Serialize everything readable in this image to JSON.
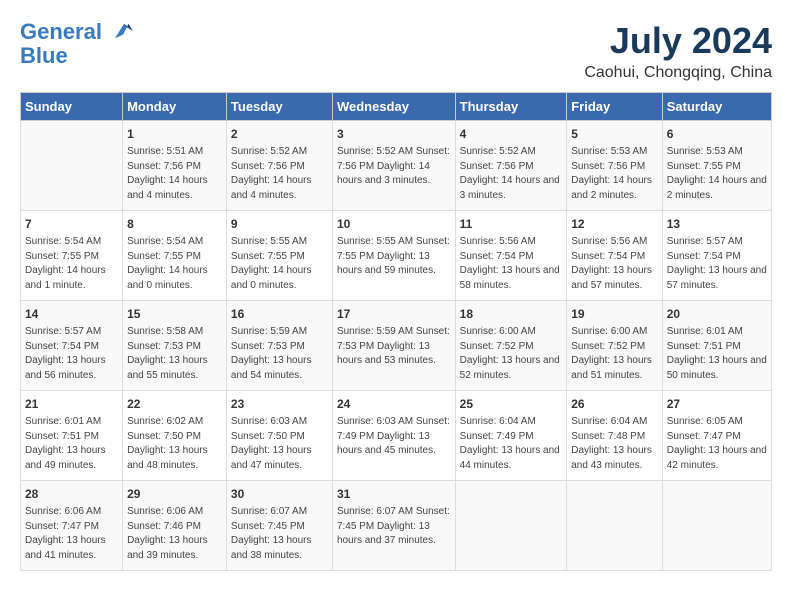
{
  "header": {
    "logo_line1": "General",
    "logo_line2": "Blue",
    "title": "July 2024",
    "subtitle": "Caohui, Chongqing, China"
  },
  "weekdays": [
    "Sunday",
    "Monday",
    "Tuesday",
    "Wednesday",
    "Thursday",
    "Friday",
    "Saturday"
  ],
  "weeks": [
    [
      {
        "day": "",
        "content": ""
      },
      {
        "day": "1",
        "content": "Sunrise: 5:51 AM\nSunset: 7:56 PM\nDaylight: 14 hours\nand 4 minutes."
      },
      {
        "day": "2",
        "content": "Sunrise: 5:52 AM\nSunset: 7:56 PM\nDaylight: 14 hours\nand 4 minutes."
      },
      {
        "day": "3",
        "content": "Sunrise: 5:52 AM\nSunset: 7:56 PM\nDaylight: 14 hours\nand 3 minutes."
      },
      {
        "day": "4",
        "content": "Sunrise: 5:52 AM\nSunset: 7:56 PM\nDaylight: 14 hours\nand 3 minutes."
      },
      {
        "day": "5",
        "content": "Sunrise: 5:53 AM\nSunset: 7:56 PM\nDaylight: 14 hours\nand 2 minutes."
      },
      {
        "day": "6",
        "content": "Sunrise: 5:53 AM\nSunset: 7:55 PM\nDaylight: 14 hours\nand 2 minutes."
      }
    ],
    [
      {
        "day": "7",
        "content": "Sunrise: 5:54 AM\nSunset: 7:55 PM\nDaylight: 14 hours\nand 1 minute."
      },
      {
        "day": "8",
        "content": "Sunrise: 5:54 AM\nSunset: 7:55 PM\nDaylight: 14 hours\nand 0 minutes."
      },
      {
        "day": "9",
        "content": "Sunrise: 5:55 AM\nSunset: 7:55 PM\nDaylight: 14 hours\nand 0 minutes."
      },
      {
        "day": "10",
        "content": "Sunrise: 5:55 AM\nSunset: 7:55 PM\nDaylight: 13 hours\nand 59 minutes."
      },
      {
        "day": "11",
        "content": "Sunrise: 5:56 AM\nSunset: 7:54 PM\nDaylight: 13 hours\nand 58 minutes."
      },
      {
        "day": "12",
        "content": "Sunrise: 5:56 AM\nSunset: 7:54 PM\nDaylight: 13 hours\nand 57 minutes."
      },
      {
        "day": "13",
        "content": "Sunrise: 5:57 AM\nSunset: 7:54 PM\nDaylight: 13 hours\nand 57 minutes."
      }
    ],
    [
      {
        "day": "14",
        "content": "Sunrise: 5:57 AM\nSunset: 7:54 PM\nDaylight: 13 hours\nand 56 minutes."
      },
      {
        "day": "15",
        "content": "Sunrise: 5:58 AM\nSunset: 7:53 PM\nDaylight: 13 hours\nand 55 minutes."
      },
      {
        "day": "16",
        "content": "Sunrise: 5:59 AM\nSunset: 7:53 PM\nDaylight: 13 hours\nand 54 minutes."
      },
      {
        "day": "17",
        "content": "Sunrise: 5:59 AM\nSunset: 7:53 PM\nDaylight: 13 hours\nand 53 minutes."
      },
      {
        "day": "18",
        "content": "Sunrise: 6:00 AM\nSunset: 7:52 PM\nDaylight: 13 hours\nand 52 minutes."
      },
      {
        "day": "19",
        "content": "Sunrise: 6:00 AM\nSunset: 7:52 PM\nDaylight: 13 hours\nand 51 minutes."
      },
      {
        "day": "20",
        "content": "Sunrise: 6:01 AM\nSunset: 7:51 PM\nDaylight: 13 hours\nand 50 minutes."
      }
    ],
    [
      {
        "day": "21",
        "content": "Sunrise: 6:01 AM\nSunset: 7:51 PM\nDaylight: 13 hours\nand 49 minutes."
      },
      {
        "day": "22",
        "content": "Sunrise: 6:02 AM\nSunset: 7:50 PM\nDaylight: 13 hours\nand 48 minutes."
      },
      {
        "day": "23",
        "content": "Sunrise: 6:03 AM\nSunset: 7:50 PM\nDaylight: 13 hours\nand 47 minutes."
      },
      {
        "day": "24",
        "content": "Sunrise: 6:03 AM\nSunset: 7:49 PM\nDaylight: 13 hours\nand 45 minutes."
      },
      {
        "day": "25",
        "content": "Sunrise: 6:04 AM\nSunset: 7:49 PM\nDaylight: 13 hours\nand 44 minutes."
      },
      {
        "day": "26",
        "content": "Sunrise: 6:04 AM\nSunset: 7:48 PM\nDaylight: 13 hours\nand 43 minutes."
      },
      {
        "day": "27",
        "content": "Sunrise: 6:05 AM\nSunset: 7:47 PM\nDaylight: 13 hours\nand 42 minutes."
      }
    ],
    [
      {
        "day": "28",
        "content": "Sunrise: 6:06 AM\nSunset: 7:47 PM\nDaylight: 13 hours\nand 41 minutes."
      },
      {
        "day": "29",
        "content": "Sunrise: 6:06 AM\nSunset: 7:46 PM\nDaylight: 13 hours\nand 39 minutes."
      },
      {
        "day": "30",
        "content": "Sunrise: 6:07 AM\nSunset: 7:45 PM\nDaylight: 13 hours\nand 38 minutes."
      },
      {
        "day": "31",
        "content": "Sunrise: 6:07 AM\nSunset: 7:45 PM\nDaylight: 13 hours\nand 37 minutes."
      },
      {
        "day": "",
        "content": ""
      },
      {
        "day": "",
        "content": ""
      },
      {
        "day": "",
        "content": ""
      }
    ]
  ]
}
